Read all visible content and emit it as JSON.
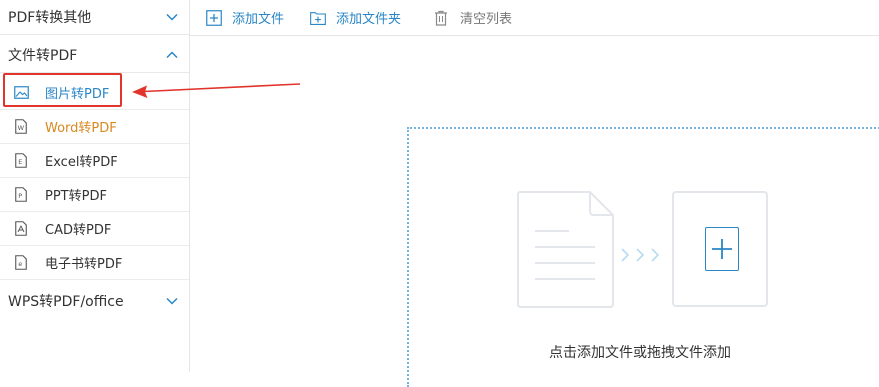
{
  "sidebar": {
    "groups": [
      {
        "label": "PDF转换其他",
        "expanded": false,
        "chevron": "chevron-down-icon"
      },
      {
        "label": "文件转PDF",
        "expanded": true,
        "chevron": "chevron-up-icon"
      },
      {
        "label": "WPS转PDF/office",
        "expanded": false,
        "chevron": "chevron-down-icon"
      }
    ],
    "items": [
      {
        "label": "图片转PDF",
        "icon": "image-icon",
        "state": "active"
      },
      {
        "label": "Word转PDF",
        "icon": "word-file-icon",
        "state": "hover"
      },
      {
        "label": "Excel转PDF",
        "icon": "excel-file-icon"
      },
      {
        "label": "PPT转PDF",
        "icon": "ppt-file-icon"
      },
      {
        "label": "CAD转PDF",
        "icon": "cad-file-icon"
      },
      {
        "label": "电子书转PDF",
        "icon": "ebook-file-icon"
      }
    ]
  },
  "toolbar": {
    "add_file": "添加文件",
    "add_folder": "添加文件夹",
    "clear_list": "清空列表"
  },
  "dropzone": {
    "hint": "点击添加文件或拖拽文件添加"
  },
  "colors": {
    "accent": "#2a86c7",
    "highlight": "#e0342c",
    "hover_text": "#d9891f"
  }
}
